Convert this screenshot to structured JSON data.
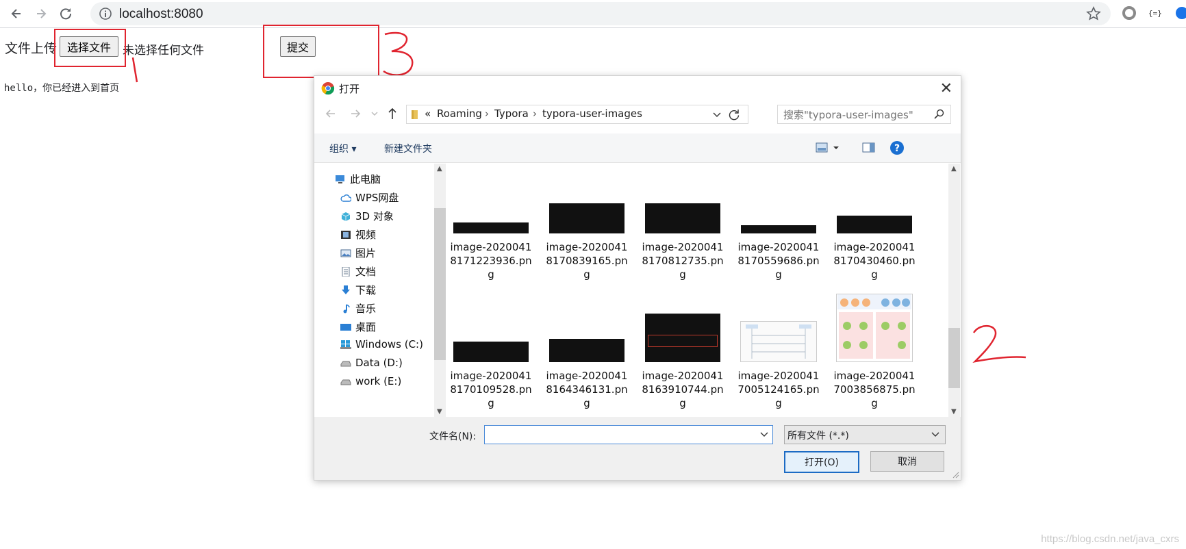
{
  "browser": {
    "url": "localhost:8080"
  },
  "page": {
    "upload_label": "文件上传",
    "choose_file_button": "选择文件",
    "no_file_text": "未选择任何文件",
    "submit_button": "提交",
    "welcome_text": "hello，你已经进入到首页"
  },
  "annotations": {
    "mark1": "1",
    "mark2": "2",
    "mark3": "3",
    "color": "#e0242f"
  },
  "dialog": {
    "title": "打开",
    "path": [
      "«",
      "Roaming",
      "Typora",
      "typora-user-images"
    ],
    "search_placeholder": "搜索\"typora-user-images\"",
    "organize": "组织 ▾",
    "new_folder": "新建文件夹",
    "help": "?",
    "nav_items": [
      {
        "label": "此电脑",
        "icon": "computer-icon"
      },
      {
        "label": "WPS网盘",
        "icon": "cloud-icon"
      },
      {
        "label": "3D 对象",
        "icon": "cube-icon"
      },
      {
        "label": "视频",
        "icon": "video-icon"
      },
      {
        "label": "图片",
        "icon": "picture-icon"
      },
      {
        "label": "文档",
        "icon": "document-icon"
      },
      {
        "label": "下载",
        "icon": "download-icon"
      },
      {
        "label": "音乐",
        "icon": "music-icon"
      },
      {
        "label": "桌面",
        "icon": "desktop-icon"
      },
      {
        "label": "Windows (C:)",
        "icon": "drive-icon"
      },
      {
        "label": "Data (D:)",
        "icon": "drive-icon"
      },
      {
        "label": "work (E:)",
        "icon": "drive-icon"
      }
    ],
    "files_row1": [
      {
        "name": "image-20200418171223936.png"
      },
      {
        "name": "image-20200418170839165.png"
      },
      {
        "name": "image-20200418170812735.png"
      },
      {
        "name": "image-20200418170559686.png"
      },
      {
        "name": "image-20200418170430460.png"
      }
    ],
    "files_row2": [
      {
        "name": "image-20200418170109528.png"
      },
      {
        "name": "image-20200418164346131.png"
      },
      {
        "name": "image-20200418163910744.png"
      },
      {
        "name": "image-20200417005124165.png"
      },
      {
        "name": "image-20200417003856875.png"
      }
    ],
    "filename_label": "文件名(N):",
    "filename_value": "",
    "filetype": "所有文件 (*.*)",
    "open_button": "打开(O)",
    "cancel_button": "取消"
  },
  "watermark": "https://blog.csdn.net/java_cxrs"
}
